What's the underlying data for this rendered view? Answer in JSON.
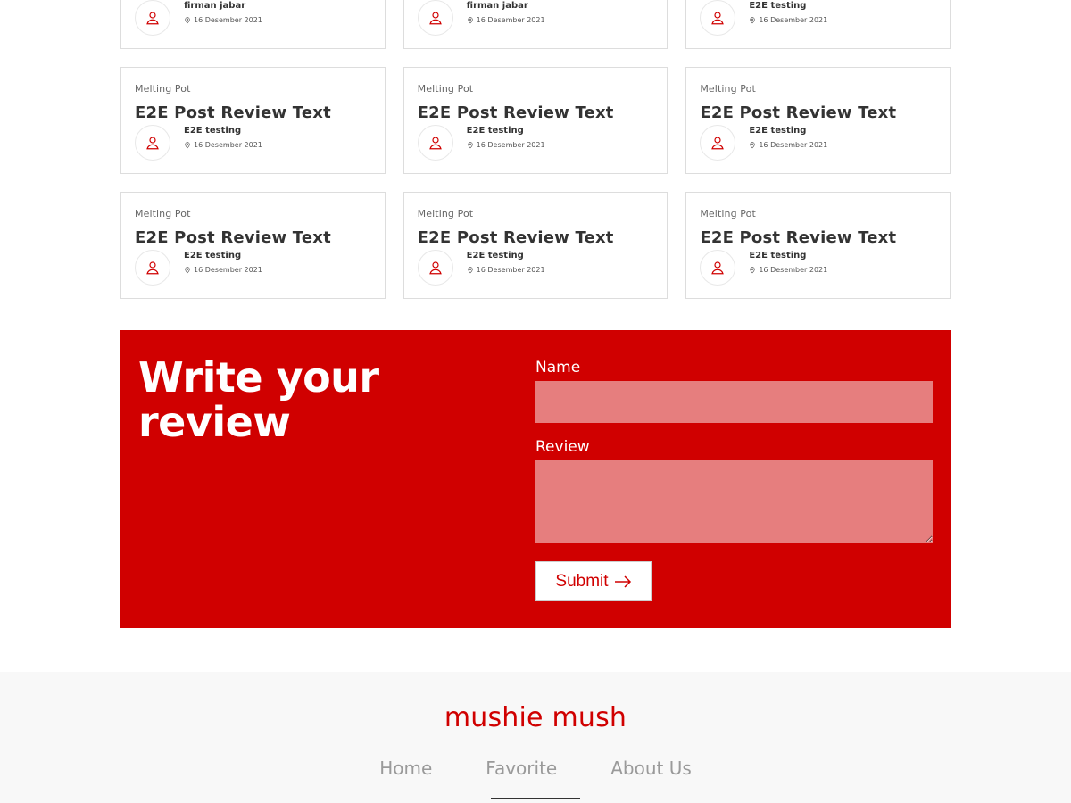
{
  "reviews": [
    [
      {
        "category": "",
        "title": "",
        "author": "firman jabar",
        "date": "16 Desember 2021"
      },
      {
        "category": "",
        "title": "",
        "author": "firman jabar",
        "date": "16 Desember 2021"
      },
      {
        "category": "",
        "title": "",
        "author": "E2E testing",
        "date": "16 Desember 2021"
      }
    ],
    [
      {
        "category": "Melting Pot",
        "title": "E2E Post Review Text",
        "author": "E2E testing",
        "date": "16 Desember 2021"
      },
      {
        "category": "Melting Pot",
        "title": "E2E Post Review Text",
        "author": "E2E testing",
        "date": "16 Desember 2021"
      },
      {
        "category": "Melting Pot",
        "title": "E2E Post Review Text",
        "author": "E2E testing",
        "date": "16 Desember 2021"
      }
    ],
    [
      {
        "category": "Melting Pot",
        "title": "E2E Post Review Text",
        "author": "E2E testing",
        "date": "16 Desember 2021"
      },
      {
        "category": "Melting Pot",
        "title": "E2E Post Review Text",
        "author": "E2E testing",
        "date": "16 Desember 2021"
      },
      {
        "category": "Melting Pot",
        "title": "E2E Post Review Text",
        "author": "E2E testing",
        "date": "16 Desember 2021"
      }
    ]
  ],
  "form": {
    "heading": "Write your review",
    "name_label": "Name",
    "name_value": "",
    "review_label": "Review",
    "review_value": "",
    "submit_label": "Submit"
  },
  "footer": {
    "brand": "mushie mush",
    "nav": [
      {
        "label": "Home"
      },
      {
        "label": "Favorite"
      },
      {
        "label": "About Us"
      }
    ]
  },
  "colors": {
    "accent": "#d00000",
    "input_bg": "#e67e7e",
    "footer_bg": "#f8f8f8"
  },
  "icons": {
    "avatar": "user-icon",
    "date": "map-pin-icon",
    "submit": "arrow-right-icon"
  }
}
